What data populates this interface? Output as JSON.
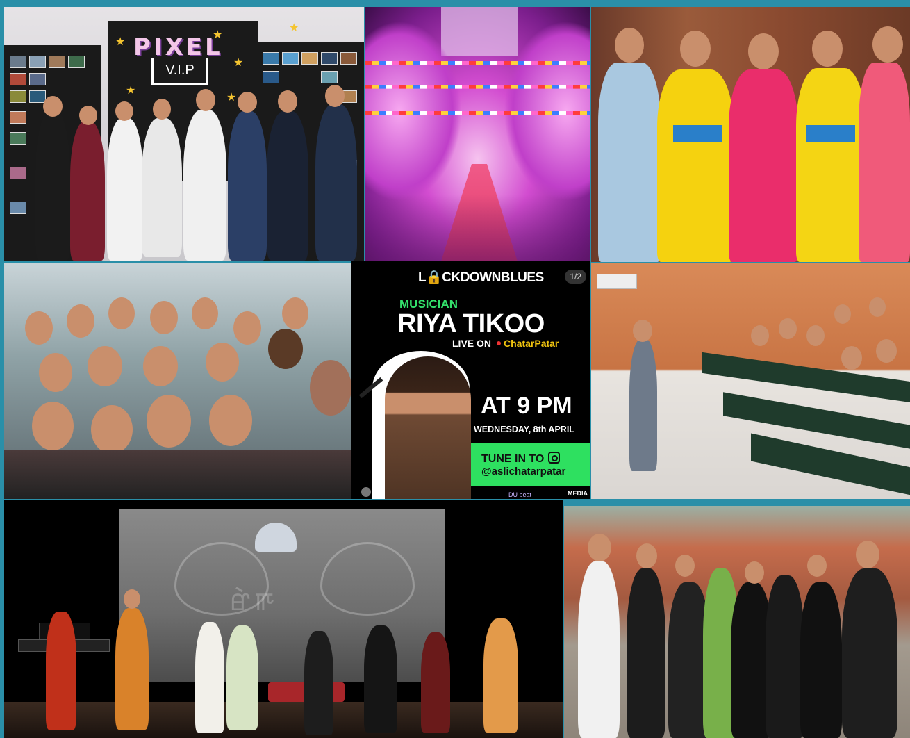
{
  "collage": {
    "tile_exhibition": {
      "logo_text": "PIXEL",
      "sign_text": "V.I.P"
    },
    "tile_poster": {
      "brand_logo": "L🔒CKDOWNBLUES",
      "page_counter": "1/2",
      "role": "MUSICIAN",
      "artist_name": "RIYA TIKOO",
      "live_on_label": "LIVE ON",
      "platform_name": "ChatarPatar",
      "time": "AT 9 PM",
      "date": "WEDNESDAY, 8th APRIL",
      "tune_in_label": "TUNE IN TO",
      "handle": "@aslichatarpatar",
      "footer_left": "DU beat",
      "footer_right": "MEDIA"
    },
    "colors": {
      "frame": "#2a8fa8",
      "poster_green": "#2ee060",
      "poster_accent_yellow": "#f1c40f"
    }
  }
}
